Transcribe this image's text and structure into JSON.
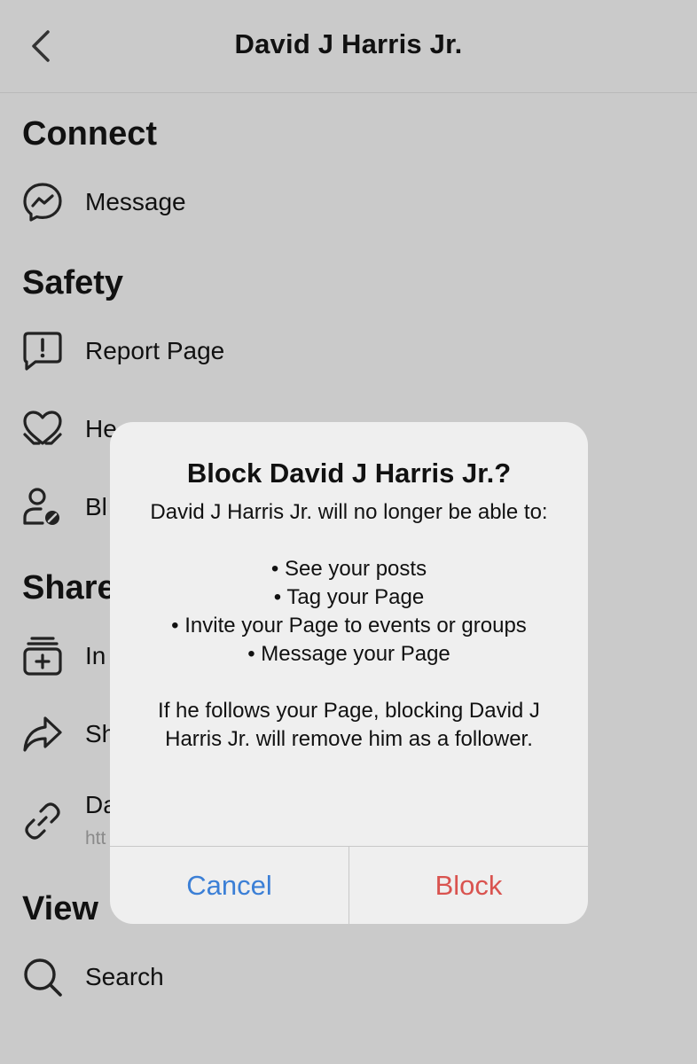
{
  "header": {
    "back_icon": "chevron-left-icon",
    "title": "David J Harris Jr."
  },
  "sections": {
    "connect": {
      "heading": "Connect",
      "items": [
        {
          "icon": "messenger-icon",
          "label": "Message"
        }
      ]
    },
    "safety": {
      "heading": "Safety",
      "items": [
        {
          "icon": "report-bubble-icon",
          "label": "Report Page"
        },
        {
          "icon": "heart-hands-icon",
          "label": "He"
        },
        {
          "icon": "user-block-icon",
          "label": "Bl"
        }
      ]
    },
    "share": {
      "heading": "Share",
      "items": [
        {
          "icon": "invite-stack-icon",
          "label": "In"
        },
        {
          "icon": "share-arrow-icon",
          "label": "Sh"
        },
        {
          "icon": "link-icon",
          "label": "Da",
          "sublabel": "htt"
        }
      ]
    },
    "view": {
      "heading": "View",
      "items": [
        {
          "icon": "search-icon",
          "label": "Search"
        }
      ]
    }
  },
  "dialog": {
    "title": "Block David J Harris Jr.?",
    "intro": "David J Harris Jr. will no longer be able to:",
    "bullets": [
      "• See your posts",
      "• Tag your Page",
      "• Invite your Page to events or groups",
      "• Message your Page"
    ],
    "footer": "If he follows your Page, blocking David J Harris Jr. will remove him as a follower.",
    "cancel_label": "Cancel",
    "block_label": "Block",
    "colors": {
      "cancel": "#3b7fd6",
      "block": "#d9534f"
    }
  }
}
